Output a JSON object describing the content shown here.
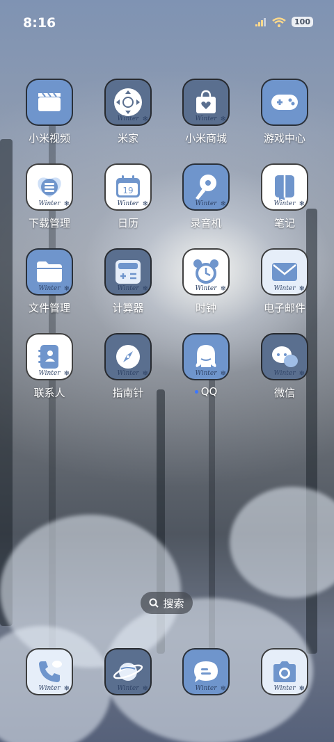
{
  "status_bar": {
    "time": "8:16",
    "battery": "100",
    "icons": [
      "signal-icon",
      "wifi-icon",
      "battery-icon"
    ]
  },
  "icon_watermark": "Winter",
  "apps": [
    {
      "label": "小米视频",
      "icon": "video-clapper-icon",
      "style": "blue"
    },
    {
      "label": "米家",
      "icon": "mijia-icon",
      "style": "photo"
    },
    {
      "label": "小米商城",
      "icon": "shopping-bag-icon",
      "style": "photo"
    },
    {
      "label": "游戏中心",
      "icon": "gamepad-icon",
      "style": "blue"
    },
    {
      "label": "下载管理",
      "icon": "download-stack-icon",
      "style": "white"
    },
    {
      "label": "日历",
      "icon": "calendar-icon",
      "style": "white",
      "badge": "19"
    },
    {
      "label": "录音机",
      "icon": "microphone-icon",
      "style": "blue"
    },
    {
      "label": "笔记",
      "icon": "notebook-icon",
      "style": "white"
    },
    {
      "label": "文件管理",
      "icon": "folder-icon",
      "style": "blue"
    },
    {
      "label": "计算器",
      "icon": "calculator-icon",
      "style": "photo"
    },
    {
      "label": "时钟",
      "icon": "alarm-clock-icon",
      "style": "white"
    },
    {
      "label": "电子邮件",
      "icon": "envelope-icon",
      "style": "light"
    },
    {
      "label": "联系人",
      "icon": "contacts-book-icon",
      "style": "white"
    },
    {
      "label": "指南针",
      "icon": "compass-icon",
      "style": "photo"
    },
    {
      "label": "QQ",
      "icon": "qq-penguin-icon",
      "style": "blue",
      "new_indicator": true
    },
    {
      "label": "微信",
      "icon": "wechat-bubbles-icon",
      "style": "photo"
    }
  ],
  "search": {
    "label": "搜索",
    "icon": "search-icon"
  },
  "dock": [
    {
      "icon": "phone-icon",
      "style": "light"
    },
    {
      "icon": "browser-planet-icon",
      "style": "photo"
    },
    {
      "icon": "message-bubble-icon",
      "style": "blue"
    },
    {
      "icon": "camera-icon",
      "style": "light"
    }
  ],
  "colors": {
    "icon_blue": "#6f95cc",
    "icon_light": "#e6eef9",
    "label_text": "#ffffff",
    "qq_dot": "#3b76ff"
  }
}
